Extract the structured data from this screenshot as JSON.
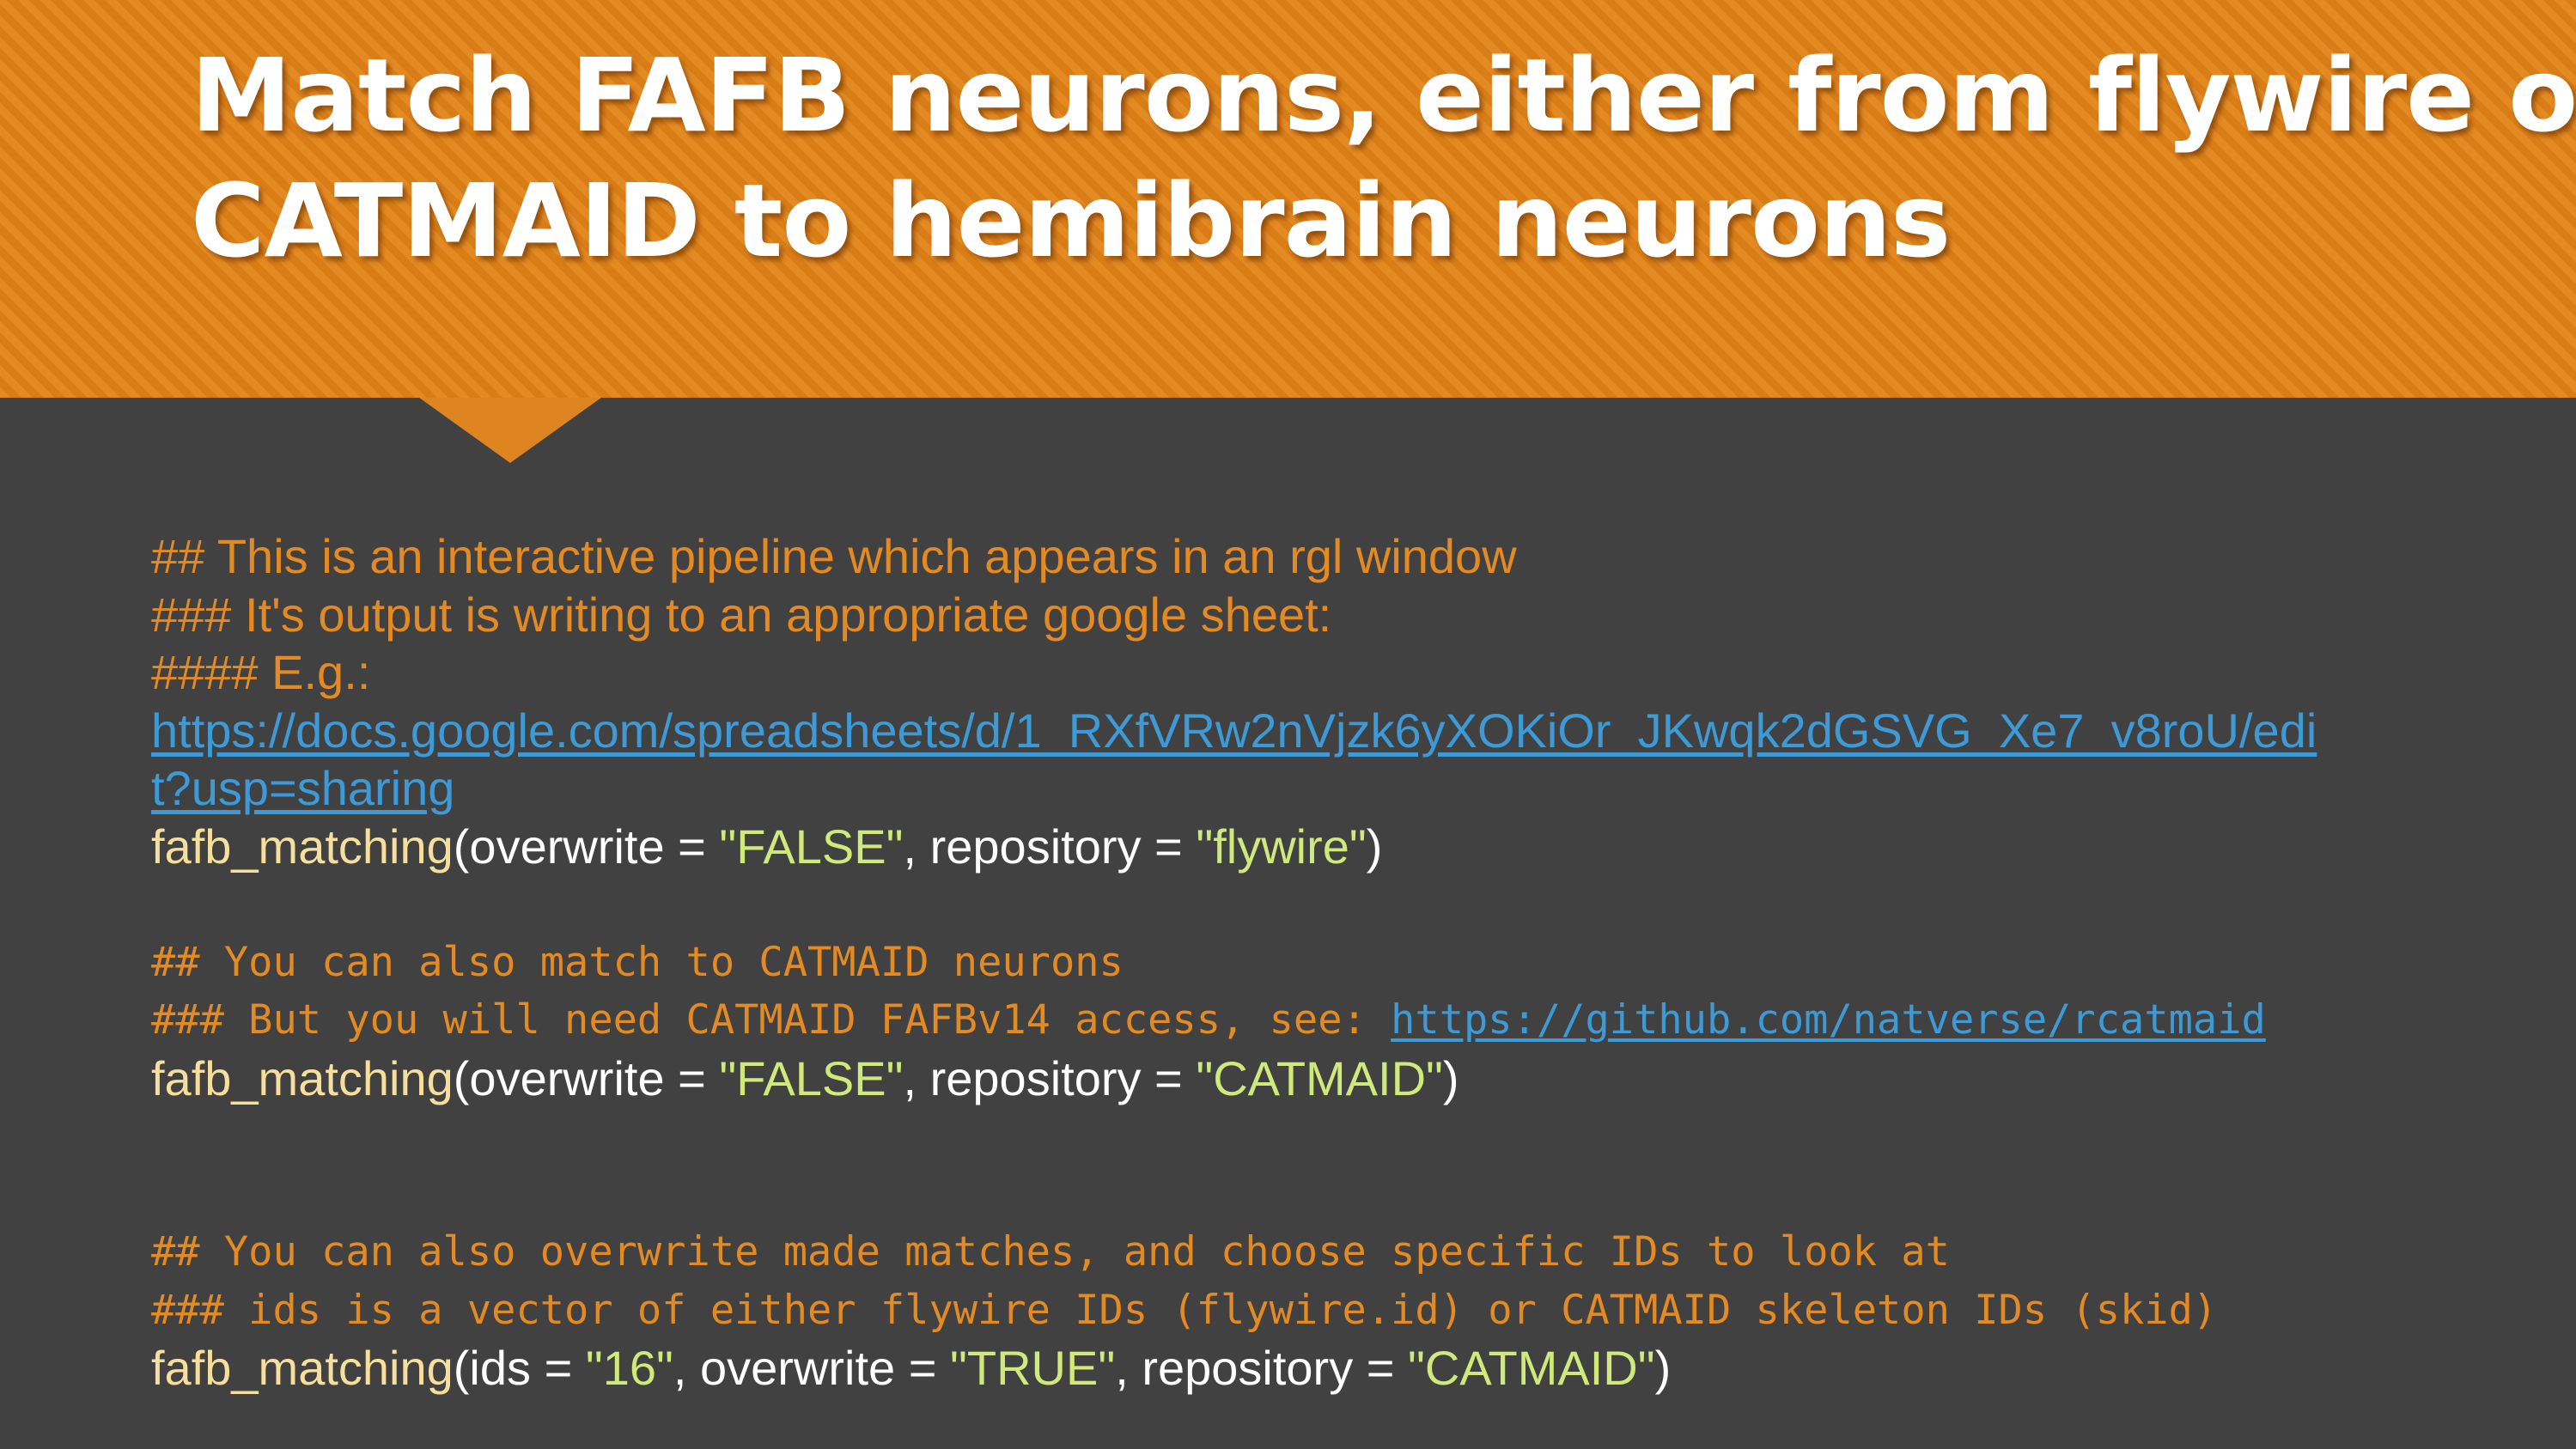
{
  "slide": {
    "title_line1": "Match FAFB neurons, either from flywire or",
    "title_line2": "CATMAID to hemibrain neurons"
  },
  "code": {
    "block1": {
      "comment1": "## This is an interactive pipeline which appears in an rgl window",
      "comment2": "### It's output is writing to an appropriate google sheet:",
      "comment3": "#### E.g.:",
      "link_part1": "https://docs.google.com/spreadsheets/d/1_RXfVRw2nVjzk6yXOKiOr_JKwqk2dGSVG_Xe7_v8roU/edi",
      "link_part2": "t?usp=sharing",
      "call": {
        "fn": "fafb_matching",
        "open": "(overwrite = ",
        "arg1": "\"FALSE\"",
        "mid": ", repository = ",
        "arg2": "\"flywire\"",
        "close": ")"
      }
    },
    "block2": {
      "comment1": "## You can also match to CATMAID neurons",
      "comment2_prefix": "### But you will need CATMAID FAFBv14 access, see: ",
      "comment2_link": "https://github.com/natverse/rcatmaid",
      "call": {
        "fn": "fafb_matching",
        "open": "(overwrite = ",
        "arg1": "\"FALSE\"",
        "mid": ", repository = ",
        "arg2": "\"CATMAID\"",
        "close": ")"
      }
    },
    "block3": {
      "comment1": "## You can also overwrite made matches, and choose specific IDs to look at",
      "comment2": "### ids is a vector of either flywire IDs (flywire.id) or CATMAID skeleton IDs (skid)",
      "call": {
        "fn": "fafb_matching",
        "open": "(ids = ",
        "arg0": "\"16\"",
        "sep0": ", overwrite = ",
        "arg1": "\"TRUE\"",
        "mid": ", repository = ",
        "arg2": "\"CATMAID\"",
        "close": ")"
      }
    }
  },
  "colors": {
    "header_orange": "#e48a23",
    "body_background": "#414141",
    "comment": "#e48a23",
    "function": "#f6df9c",
    "string": "#d1e87a",
    "link": "#3d9ad6",
    "text": "#ffffff"
  }
}
